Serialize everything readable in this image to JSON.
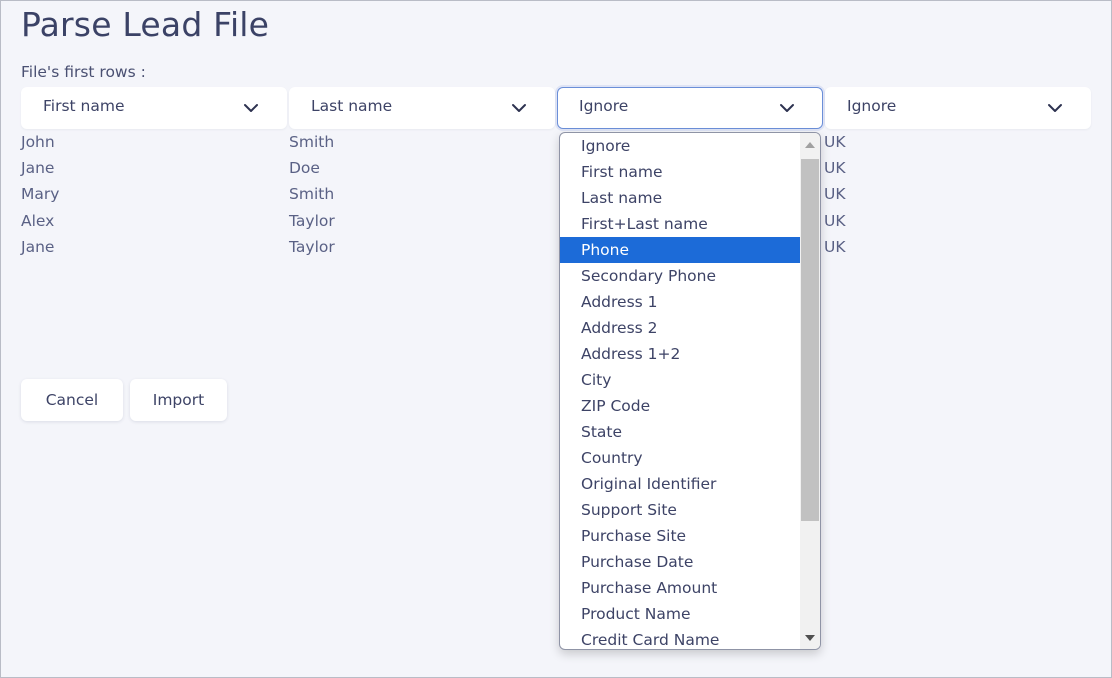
{
  "page": {
    "title": "Parse Lead File",
    "subtitle": "File's first rows :"
  },
  "columns": [
    {
      "selected": "First name"
    },
    {
      "selected": "Last name"
    },
    {
      "selected": "Ignore"
    },
    {
      "selected": "Ignore"
    }
  ],
  "rows": [
    [
      "John",
      "Smith",
      "",
      "UK"
    ],
    [
      "Jane",
      "Doe",
      "",
      "UK"
    ],
    [
      "Mary",
      "Smith",
      "",
      "UK"
    ],
    [
      "Alex",
      "Taylor",
      "",
      "UK"
    ],
    [
      "Jane",
      "Taylor",
      "",
      "UK"
    ]
  ],
  "actions": {
    "cancel_label": "Cancel",
    "import_label": "Import"
  },
  "dropdown": {
    "highlighted": "Phone",
    "options": [
      "Ignore",
      "First name",
      "Last name",
      "First+Last name",
      "Phone",
      "Secondary Phone",
      "Address 1",
      "Address 2",
      "Address 1+2",
      "City",
      "ZIP Code",
      "State",
      "Country",
      "Original Identifier",
      "Support Site",
      "Purchase Site",
      "Purchase Date",
      "Purchase Amount",
      "Product Name",
      "Credit Card Name"
    ]
  },
  "icons": {
    "chevron": "chevron-down-icon",
    "scroll_up": "scroll-up-arrow-icon",
    "scroll_down": "scroll-down-arrow-icon"
  },
  "colors": {
    "background": "#f4f5fa",
    "title": "#3b4266",
    "highlight": "#1c6bd8",
    "active_border": "#6b8fd8"
  }
}
